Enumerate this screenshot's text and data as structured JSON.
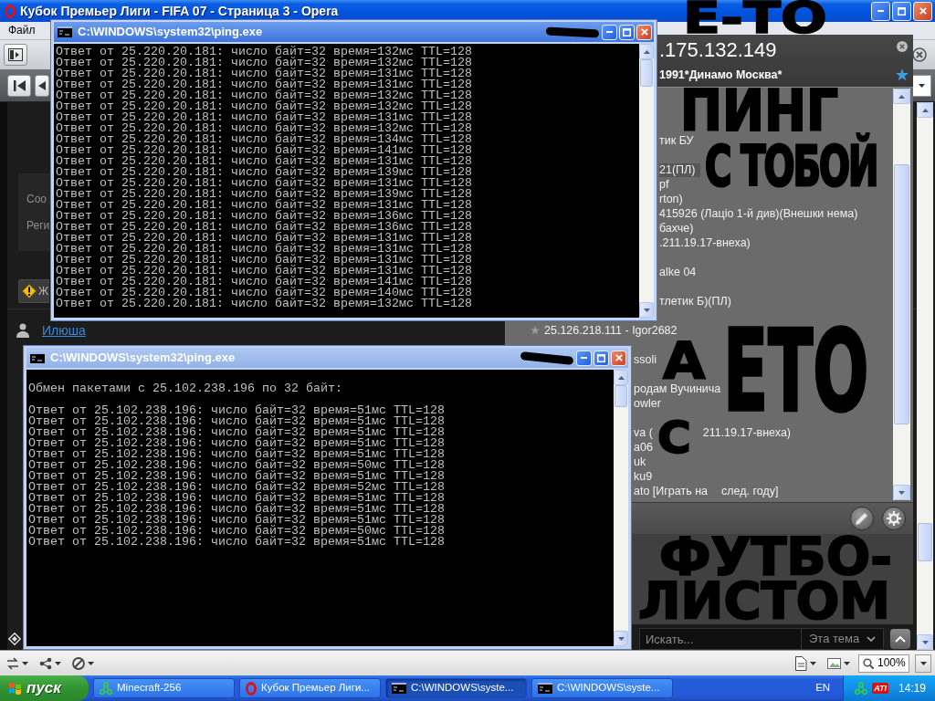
{
  "browser": {
    "title": "Кубок Премьер Лиги - FIFA 07 - Страница 3 - Opera",
    "menu": [
      "Файл"
    ],
    "page": {
      "panel_labels": [
        "Соо",
        "Реги"
      ],
      "warning_button": "Ж",
      "user_link": "Илюша",
      "search": {
        "placeholder": "Искать...",
        "scope": "Эта тема"
      }
    },
    "status_bar": {
      "zoom": "100%"
    }
  },
  "chat_panel": {
    "title": ".175.132.149",
    "subtitle": "1991*Динамо Москва*",
    "items": [
      {
        "kind": "covered"
      },
      {
        "kind": "covered"
      },
      {
        "kind": "covered"
      },
      {
        "kind": "contact",
        "text": "тик БУ",
        "selected": false
      },
      {
        "kind": "covered"
      },
      {
        "kind": "contact",
        "text": "21(ПЛ)",
        "selected": true
      },
      {
        "kind": "contact",
        "text": "pf",
        "selected": false
      },
      {
        "kind": "contact",
        "text": "rton)",
        "selected": false
      },
      {
        "kind": "contact",
        "text": "415926 (Лаціо 1-й див)(Внешки нема)",
        "selected": false
      },
      {
        "kind": "contact",
        "text": "бахче)",
        "selected": false
      },
      {
        "kind": "contact",
        "text": ".211.19.17-внеха)",
        "selected": false
      },
      {
        "kind": "covered"
      },
      {
        "kind": "contact",
        "text": "alke 04",
        "selected": false
      },
      {
        "kind": "covered"
      },
      {
        "kind": "contact",
        "text": "тлетик Б)(ПЛ)",
        "selected": false
      },
      {
        "kind": "covered"
      },
      {
        "kind": "contact",
        "text": "25.126.218.111 - Igor2682",
        "selected": false
      },
      {
        "kind": "covered"
      },
      {
        "kind": "contact",
        "text": "ssoli",
        "selected": false
      },
      {
        "kind": "covered"
      },
      {
        "kind": "contact",
        "text": "родам Вучинича",
        "selected": false
      },
      {
        "kind": "contact",
        "text": "owler",
        "selected": false
      },
      {
        "kind": "covered"
      },
      {
        "kind": "contact",
        "text": "va (",
        "tail": "211.19.17-внеха)",
        "selected": false
      },
      {
        "kind": "contact",
        "text": "a06",
        "selected": false
      },
      {
        "kind": "contact",
        "text": "uk",
        "selected": false
      },
      {
        "kind": "contact",
        "text": "ku9",
        "selected": false
      },
      {
        "kind": "contact",
        "text": "ato [Играть на",
        "tail": "след. году]",
        "selected": false
      }
    ]
  },
  "consoles": [
    {
      "title": "C:\\WINDOWS\\system32\\ping.exe",
      "active": true,
      "lines": [
        "Ответ от 25.220.20.181: число байт=32 время=132мс TTL=128",
        "Ответ от 25.220.20.181: число байт=32 время=132мс TTL=128",
        "Ответ от 25.220.20.181: число байт=32 время=131мс TTL=128",
        "Ответ от 25.220.20.181: число байт=32 время=131мс TTL=128",
        "Ответ от 25.220.20.181: число байт=32 время=132мс TTL=128",
        "Ответ от 25.220.20.181: число байт=32 время=132мс TTL=128",
        "Ответ от 25.220.20.181: число байт=32 время=131мс TTL=128",
        "Ответ от 25.220.20.181: число байт=32 время=132мс TTL=128",
        "Ответ от 25.220.20.181: число байт=32 время=134мс TTL=128",
        "Ответ от 25.220.20.181: число байт=32 время=141мс TTL=128",
        "Ответ от 25.220.20.181: число байт=32 время=131мс TTL=128",
        "Ответ от 25.220.20.181: число байт=32 время=139мс TTL=128",
        "Ответ от 25.220.20.181: число байт=32 время=131мс TTL=128",
        "Ответ от 25.220.20.181: число байт=32 время=139мс TTL=128",
        "Ответ от 25.220.20.181: число байт=32 время=131мс TTL=128",
        "Ответ от 25.220.20.181: число байт=32 время=136мс TTL=128",
        "Ответ от 25.220.20.181: число байт=32 время=136мс TTL=128",
        "Ответ от 25.220.20.181: число байт=32 время=131мс TTL=128",
        "Ответ от 25.220.20.181: число байт=32 время=131мс TTL=128",
        "Ответ от 25.220.20.181: число байт=32 время=131мс TTL=128",
        "Ответ от 25.220.20.181: число байт=32 время=131мс TTL=128",
        "Ответ от 25.220.20.181: число байт=32 время=141мс TTL=128",
        "Ответ от 25.220.20.181: число байт=32 время=140мс TTL=128",
        "Ответ от 25.220.20.181: число байт=32 время=132мс TTL=128"
      ]
    },
    {
      "title": "C:\\WINDOWS\\system32\\ping.exe",
      "active": false,
      "header": "Обмен пакетами с 25.102.238.196 по 32 байт:",
      "lines": [
        "Ответ от 25.102.238.196: число байт=32 время=51мс TTL=128",
        "Ответ от 25.102.238.196: число байт=32 время=51мс TTL=128",
        "Ответ от 25.102.238.196: число байт=32 время=51мс TTL=128",
        "Ответ от 25.102.238.196: число байт=32 время=51мс TTL=128",
        "Ответ от 25.102.238.196: число байт=32 время=51мс TTL=128",
        "Ответ от 25.102.238.196: число байт=32 время=50мс TTL=128",
        "Ответ от 25.102.238.196: число байт=32 время=51мс TTL=128",
        "Ответ от 25.102.238.196: число байт=32 время=52мс TTL=128",
        "Ответ от 25.102.238.196: число байт=32 время=51мс TTL=128",
        "Ответ от 25.102.238.196: число байт=32 время=51мс TTL=128",
        "Ответ от 25.102.238.196: число байт=32 время=51мс TTL=128",
        "Ответ от 25.102.238.196: число байт=32 время=50мс TTL=128",
        "Ответ от 25.102.238.196: число байт=32 время=51мс TTL=128"
      ]
    }
  ],
  "handwriting": [
    "Е-ТО",
    "ПИНГ",
    "С ТОБОЙ",
    "А",
    "ЕТО",
    "С",
    "ФУТБО-",
    "ЛИСТОМ"
  ],
  "taskbar": {
    "start": "пуск",
    "tasks": [
      {
        "label": "Minecraft-256",
        "kind": "network",
        "selected": false
      },
      {
        "label": "Кубок Премьер Лиги...",
        "kind": "browser",
        "selected": false
      },
      {
        "label": "C:\\WINDOWS\\syste...",
        "kind": "console",
        "selected": true
      },
      {
        "label": "C:\\WINDOWS\\syste...",
        "kind": "console",
        "selected": false
      }
    ],
    "language": "EN",
    "tray_logo": "ATI",
    "clock": "14:19"
  }
}
